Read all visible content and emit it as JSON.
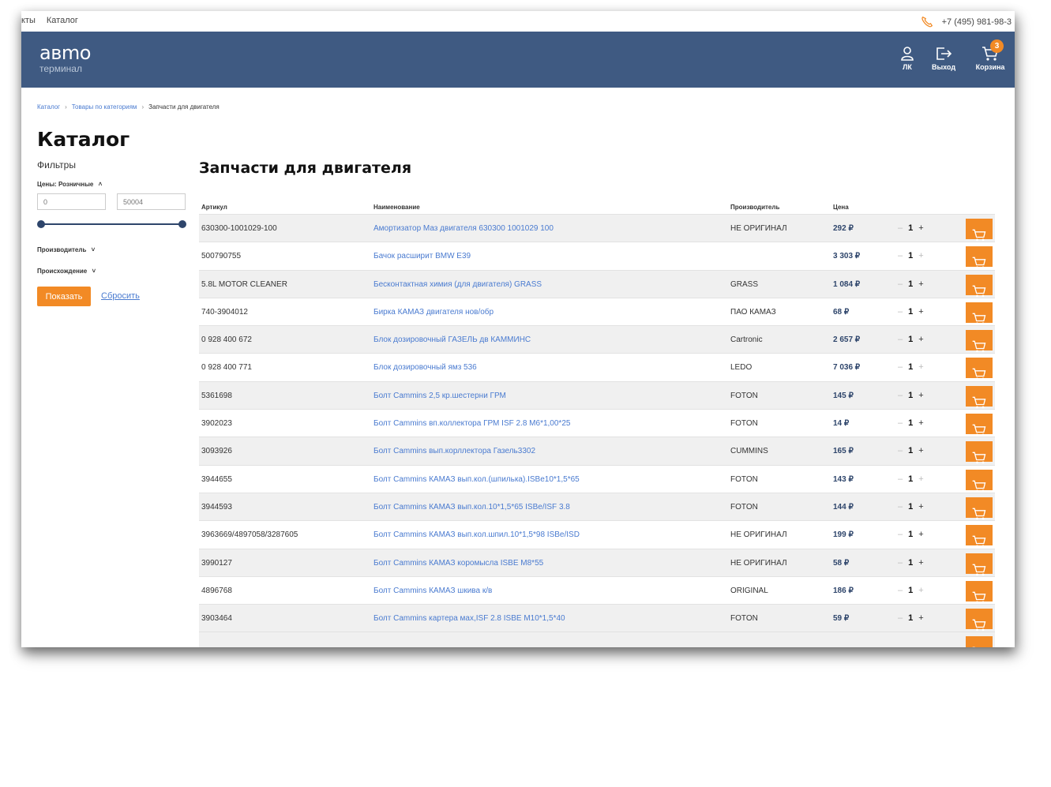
{
  "topbar": {
    "nav": [
      "кты",
      "Каталог"
    ],
    "phone": "+7 (495) 981-98-3"
  },
  "header": {
    "logo_line1": "aвmo",
    "logo_line2": "терминал",
    "account_label": "ЛК",
    "exit_label": "Выход",
    "cart_label": "Корзина",
    "cart_count": "3"
  },
  "breadcrumb": [
    "Каталог",
    "Товары по категориям",
    "Запчасти для двигателя"
  ],
  "page_title": "Каталог",
  "filters": {
    "title": "Фильтры",
    "price_label": "Цены: Розничные",
    "price_min": "0",
    "price_max": "50004",
    "manufacturer_label": "Производитель",
    "origin_label": "Происхождение",
    "show_label": "Показать",
    "reset_label": "Сбросить"
  },
  "section_title": "Запчасти для двигателя",
  "table": {
    "columns": [
      "Артикул",
      "Наименование",
      "Производитель",
      "Цена"
    ],
    "rows": [
      {
        "article": "630300-1001029-100",
        "name": "Амортизатор Маз двигателя 630300 1001029 100",
        "maker": "НЕ ОРИГИНАЛ",
        "price": "292 ₽",
        "qty": "1"
      },
      {
        "article": "500790755",
        "name": "Бачок расширит BMW E39",
        "maker": "",
        "price": "3 303 ₽",
        "qty": "1"
      },
      {
        "article": "5.8L MOTOR CLEANER",
        "name": "Бесконтактная химия (для двигателя) GRASS",
        "maker": "GRASS",
        "price": "1 084 ₽",
        "qty": "1"
      },
      {
        "article": "740-3904012",
        "name": "Бирка КАМАЗ двигателя нов/обр",
        "maker": "ПАО КАМАЗ",
        "price": "68 ₽",
        "qty": "1"
      },
      {
        "article": "0 928 400 672",
        "name": "Блок дозировочный ГАЗЕЛЬ дв КАММИНС",
        "maker": "Cartronic",
        "price": "2 657 ₽",
        "qty": "1"
      },
      {
        "article": "0 928 400 771",
        "name": "Блок дозировочный ямз 536",
        "maker": "LEDO",
        "price": "7 036 ₽",
        "qty": "1"
      },
      {
        "article": "5361698",
        "name": "Болт Cammins 2,5 кр.шестерни ГРМ",
        "maker": "FOTON",
        "price": "145 ₽",
        "qty": "1"
      },
      {
        "article": "3902023",
        "name": "Болт Cammins вп.коллектора ГРМ ISF 2.8 M6*1,00*25",
        "maker": "FOTON",
        "price": "14 ₽",
        "qty": "1"
      },
      {
        "article": "3093926",
        "name": "Болт Cammins вып.корллектора Газель3302",
        "maker": "CUMMINS",
        "price": "165 ₽",
        "qty": "1"
      },
      {
        "article": "3944655",
        "name": "Болт Cammins КАМАЗ вып.кол.(шпилька).ISBe10*1,5*65",
        "maker": "FOTON",
        "price": "143 ₽",
        "qty": "1"
      },
      {
        "article": "3944593",
        "name": "Болт Cammins КАМАЗ вып.кол.10*1,5*65 ISBe/ISF 3.8",
        "maker": "FOTON",
        "price": "144 ₽",
        "qty": "1"
      },
      {
        "article": "3963669/4897058/3287605",
        "name": "Болт Cammins КАМАЗ вып.кол.шпил.10*1,5*98 ISBe/ISD",
        "maker": "НЕ ОРИГИНАЛ",
        "price": "199 ₽",
        "qty": "1"
      },
      {
        "article": "3990127",
        "name": "Болт Cammins КАМАЗ коромысла ISBE M8*55",
        "maker": "НЕ ОРИГИНАЛ",
        "price": "58 ₽",
        "qty": "1"
      },
      {
        "article": "4896768",
        "name": "Болт Cammins КАМАЗ шкива к/в",
        "maker": "ORIGINAL",
        "price": "186 ₽",
        "qty": "1"
      },
      {
        "article": "3903464",
        "name": "Болт Cammins картера мах,ISF 2.8 ISBE M10*1,5*40",
        "maker": "FOTON",
        "price": "59 ₽",
        "qty": "1"
      }
    ]
  },
  "colors": {
    "header_bg": "#3f5a82",
    "accent": "#f28a25",
    "link": "#4a7bd0"
  }
}
